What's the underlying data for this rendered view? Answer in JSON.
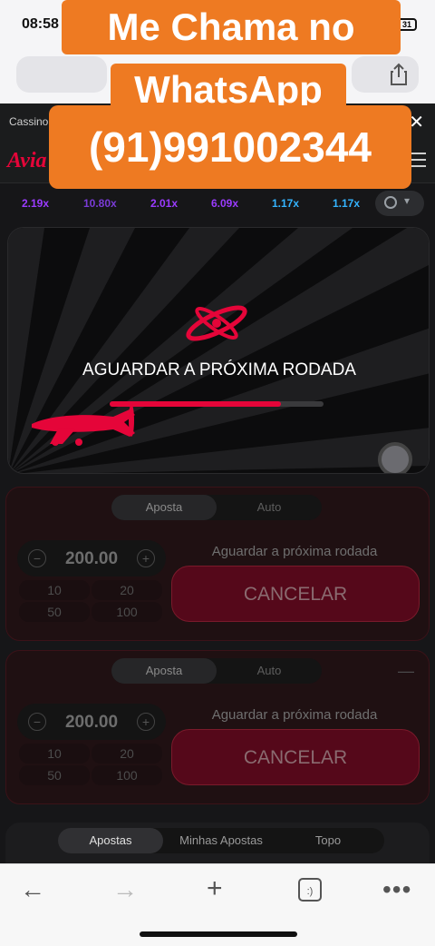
{
  "status": {
    "time": "08:58",
    "battery": "31"
  },
  "game": {
    "top_label": "Cassino",
    "logo": "Avia",
    "multipliers": [
      {
        "value": "2.19x",
        "color": "#9b3bff"
      },
      {
        "value": "10.80x",
        "color": "#7a3bd6"
      },
      {
        "value": "2.01x",
        "color": "#9b3bff"
      },
      {
        "value": "6.09x",
        "color": "#9b3bff"
      },
      {
        "value": "1.17x",
        "color": "#34b4ff"
      },
      {
        "value": "1.17x",
        "color": "#34b4ff"
      }
    ],
    "wait_message": "AGUARDAR A PRÓXIMA RODADA",
    "progress": 0.8,
    "bet_panels": [
      {
        "tabs": [
          "Aposta",
          "Auto"
        ],
        "amount": "200.00",
        "quick": [
          "10",
          "20",
          "50",
          "100"
        ],
        "wait_label": "Aguardar a próxima rodada",
        "button": "CANCELAR"
      },
      {
        "tabs": [
          "Aposta",
          "Auto"
        ],
        "amount": "200.00",
        "quick": [
          "10",
          "20",
          "50",
          "100"
        ],
        "wait_label": "Aguardar a próxima rodada",
        "button": "CANCELAR"
      }
    ],
    "bottom_tabs": [
      "Apostas",
      "Minhas Apostas",
      "Topo"
    ]
  },
  "promo": {
    "line1": "Me Chama no",
    "line2": "WhatsApp",
    "line3": "(91)991002344"
  },
  "colors": {
    "accent": "#e50539",
    "promo": "#ee7a22"
  }
}
